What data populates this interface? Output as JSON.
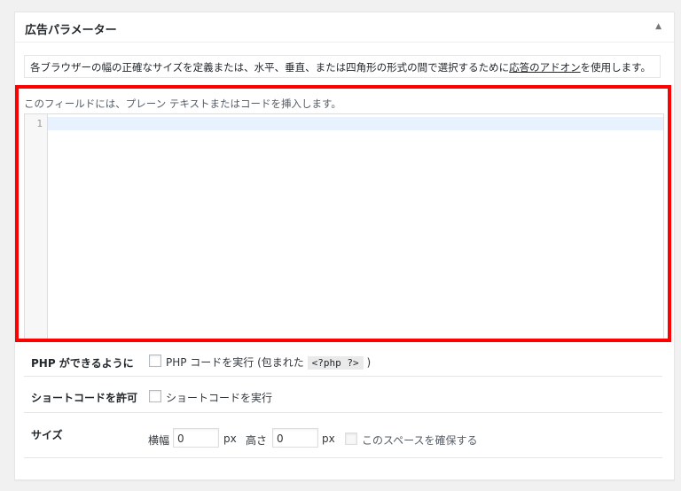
{
  "box": {
    "title": "広告パラメーター",
    "toggle_icon": "▲"
  },
  "description": {
    "text_before": "各ブラウザーの幅の正確なサイズを定義または、水平、垂直、または四角形の形式の間で選択するために",
    "link": "応答のアドオン",
    "text_after": "を使用します。"
  },
  "editor": {
    "hint": "このフィールドには、プレーン テキストまたはコードを挿入します。",
    "line_number": "1",
    "highlight_color": "#ff0000"
  },
  "options": {
    "php": {
      "label": "PHP ができるように",
      "checkbox_text": "PHP コードを実行 (包まれた",
      "code": "<?php ?>",
      "close_paren": ")"
    },
    "shortcode": {
      "label": "ショートコードを許可",
      "checkbox_text": "ショートコードを実行"
    },
    "size": {
      "label": "サイズ",
      "width_label": "横幅",
      "width_value": "0",
      "width_unit": "px",
      "height_label": "高さ",
      "height_value": "0",
      "height_unit": "px",
      "reserve_text": "このスペースを確保する"
    }
  }
}
